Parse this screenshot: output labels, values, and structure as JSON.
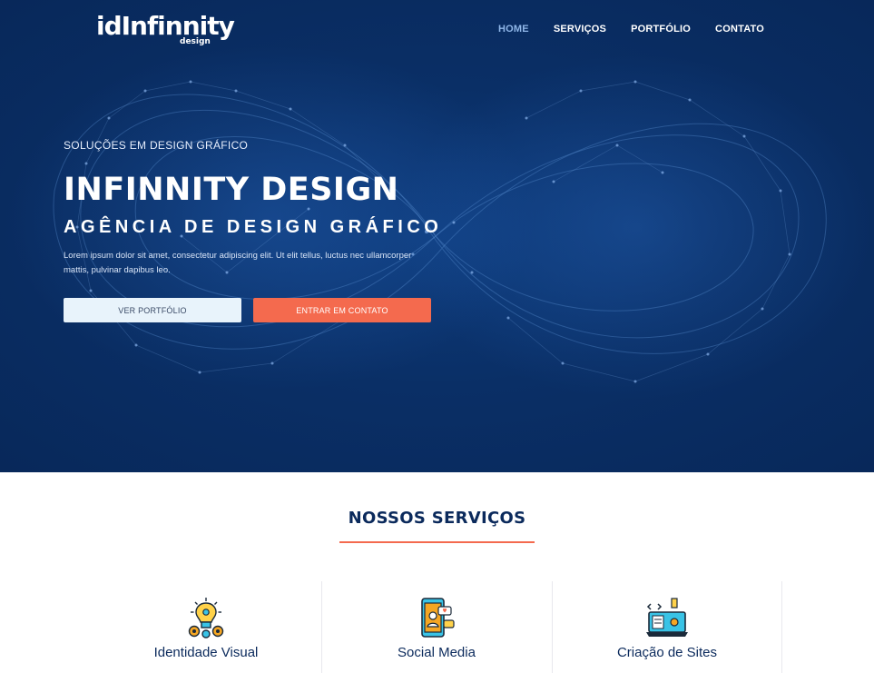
{
  "brand": {
    "logo_main": "idInfinnity",
    "logo_sub": "design"
  },
  "nav": {
    "items": [
      {
        "label": "HOME",
        "active": true
      },
      {
        "label": "SERVIÇOS",
        "active": false
      },
      {
        "label": "PORTFÓLIO",
        "active": false
      },
      {
        "label": "CONTATO",
        "active": false
      }
    ]
  },
  "hero": {
    "eyebrow": "SOLUÇÕES EM DESIGN GRÁFICO",
    "title": "INFINNITY DESIGN",
    "subtitle": "AGÊNCIA DE DESIGN GRÁFICO",
    "description": "Lorem ipsum dolor sit amet, consectetur adipiscing elit. Ut elit tellus, luctus nec ullamcorper mattis, pulvinar dapibus leo.",
    "btn_portfolio": "VER PORTFÓLIO",
    "btn_contact": "ENTRAR EM CONTATO"
  },
  "services": {
    "title": "NOSSOS SERVIÇOS",
    "items": [
      {
        "label": "Identidade Visual",
        "icon": "lightbulb-gears-icon"
      },
      {
        "label": "Social Media",
        "icon": "smartphone-social-icon"
      },
      {
        "label": "Criação de Sites",
        "icon": "laptop-code-icon"
      }
    ]
  },
  "colors": {
    "hero_bg": "#0a2f66",
    "accent": "#f46a4e",
    "title_navy": "#0b2a5c",
    "nav_active": "#8fb6e8"
  }
}
